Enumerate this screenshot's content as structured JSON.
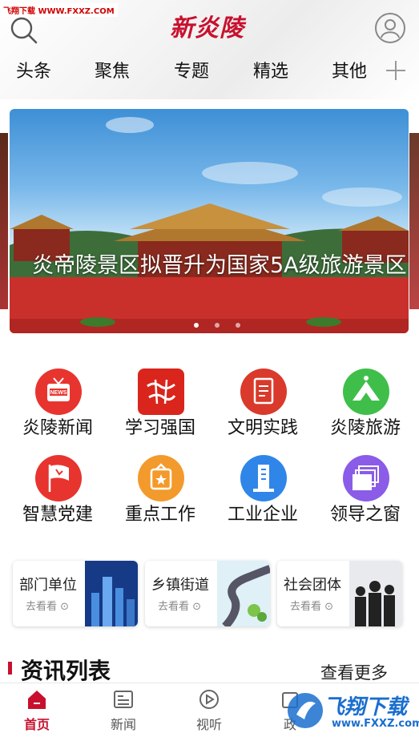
{
  "watermark": {
    "brand": "飞翔下载",
    "url": "WWW.FXXZ.COM"
  },
  "header": {
    "logo": "新炎陵"
  },
  "tabs": [
    "头条",
    "聚焦",
    "专题",
    "精选",
    "其他"
  ],
  "carousel": {
    "caption": "炎帝陵景区拟晋升为国家5A级旅游景区",
    "slide_count": 3,
    "active_index": 0
  },
  "grid": [
    {
      "label": "炎陵新闻",
      "icon": "news-tv-icon",
      "color": "#e8342f"
    },
    {
      "label": "学习强国",
      "icon": "xuexi-icon",
      "color": "#d9251c"
    },
    {
      "label": "文明实践",
      "icon": "document-icon",
      "color": "#d93a2b"
    },
    {
      "label": "炎陵旅游",
      "icon": "mountain-icon",
      "color": "#3fbf4a"
    },
    {
      "label": "智慧党建",
      "icon": "party-flag-icon",
      "color": "#e8342f"
    },
    {
      "label": "重点工作",
      "icon": "star-badge-icon",
      "color": "#f39a2c"
    },
    {
      "label": "工业企业",
      "icon": "building-icon",
      "color": "#2f86e8"
    },
    {
      "label": "领导之窗",
      "icon": "windows-icon",
      "color": "#8a5ce8"
    }
  ],
  "cards": [
    {
      "title": "部门单位",
      "sub": "去看看"
    },
    {
      "title": "乡镇街道",
      "sub": "去看看"
    },
    {
      "title": "社会团体",
      "sub": "去看看"
    }
  ],
  "section": {
    "title": "资讯列表",
    "more": "查看更多"
  },
  "bottom_nav": [
    {
      "label": "首页",
      "icon": "home-icon",
      "active": true
    },
    {
      "label": "新闻",
      "icon": "news-icon",
      "active": false
    },
    {
      "label": "视听",
      "icon": "play-icon",
      "active": false
    },
    {
      "label": "政",
      "icon": "gov-icon",
      "active": false
    }
  ],
  "brand_watermark": {
    "title": "飞翔下载",
    "url": "www.FXXZ.com"
  },
  "colors": {
    "accent": "#c8102e",
    "link_blue": "#1a6ecf"
  }
}
